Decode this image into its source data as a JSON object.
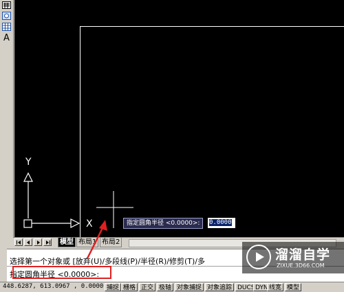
{
  "left_toolbar": {
    "text_tool_label": "A"
  },
  "canvas": {
    "ucs_y_label": "Y",
    "ucs_x_label": "X",
    "background_color": "#000000",
    "dyn_prompt": "指定圆角半径 <0.0000>:",
    "dyn_input_value": "0.0000"
  },
  "tabs": {
    "model": "模型",
    "layout1": "布局1",
    "layout2": "布局2"
  },
  "command_window": {
    "history_line": "选择第一个对象或 [放弃(U)/多段线(P)/半径(R)/修剪(T)/多",
    "current_line": "指定圆角半径 <0.0000>:",
    "highlight_color": "#e02020"
  },
  "watermark": {
    "title": "溜溜自学",
    "url": "ZIXUE.3D66.COM"
  },
  "status_bar": {
    "coordinates": "448.6287,  613.0967 , 0.0000",
    "buttons": [
      "捕捉",
      "栅格",
      "正交",
      "极轴",
      "对象捕捉",
      "对象追踪",
      "DUCS",
      "DYN",
      "线宽",
      "模型"
    ]
  }
}
